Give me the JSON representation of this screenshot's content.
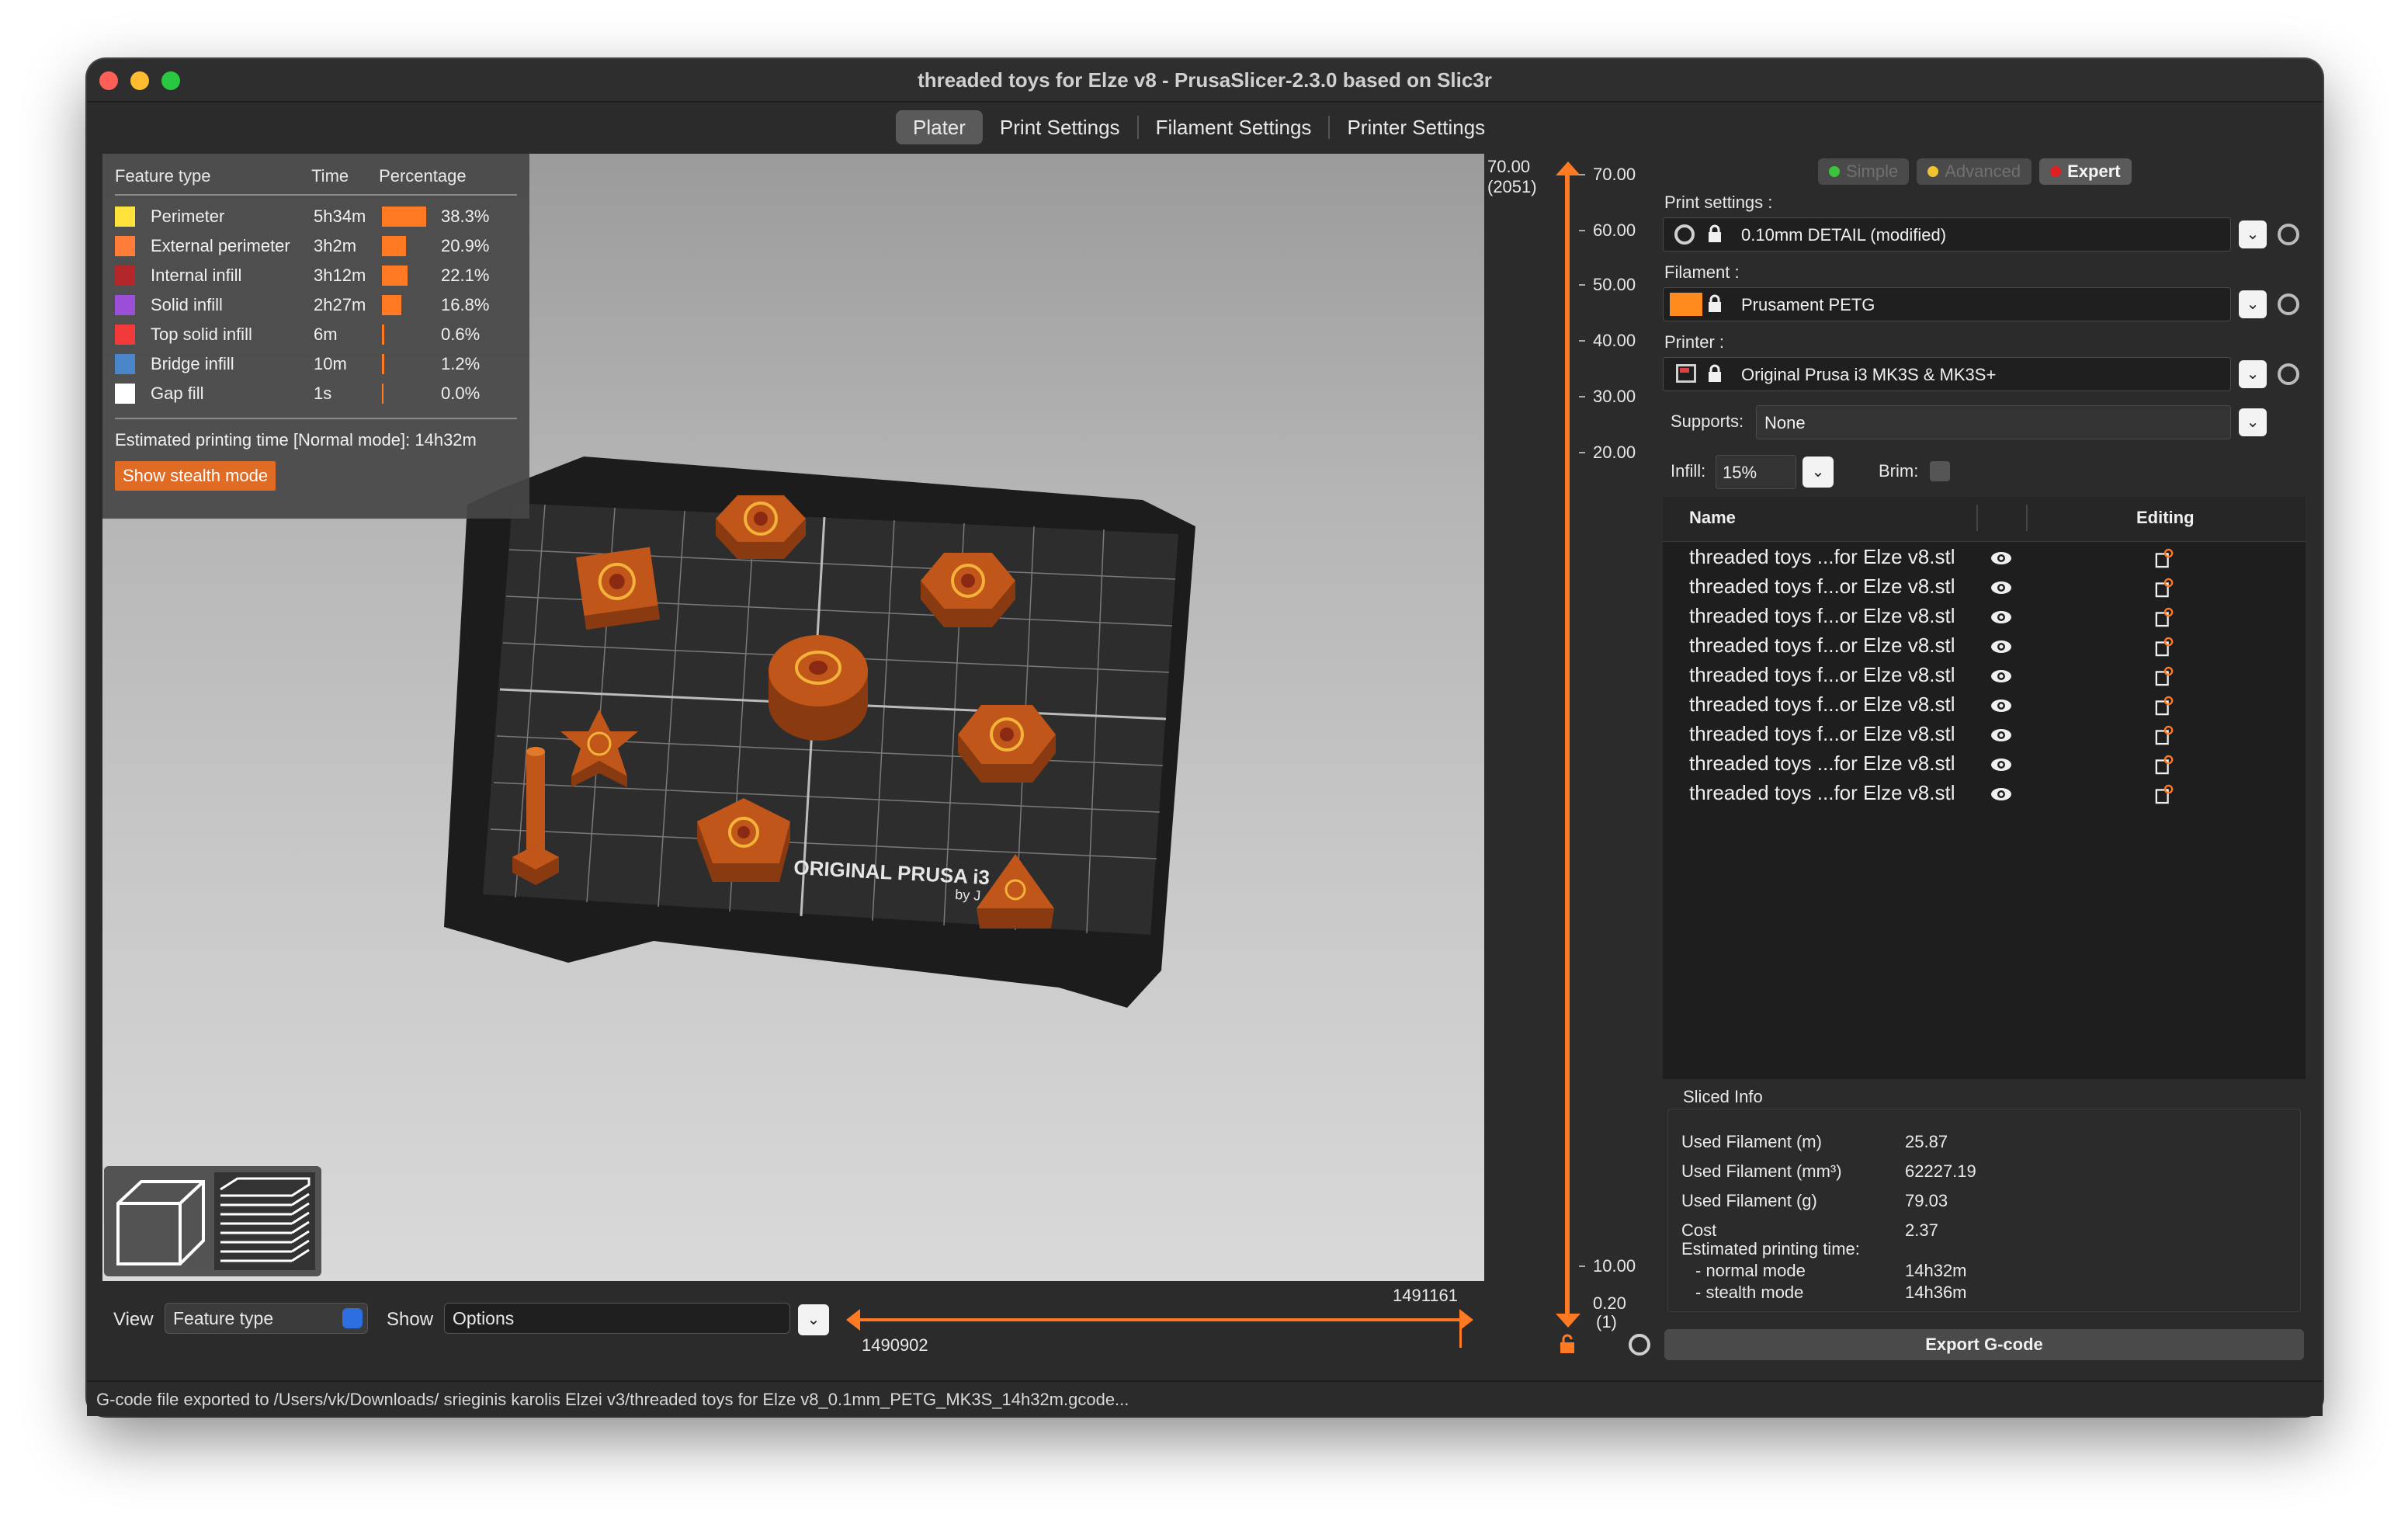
{
  "window": {
    "title": "threaded toys for Elze v8 - PrusaSlicer-2.3.0 based on Slic3r"
  },
  "tabs": [
    {
      "label": "Plater",
      "active": true
    },
    {
      "label": "Print Settings",
      "active": false
    },
    {
      "label": "Filament Settings",
      "active": false
    },
    {
      "label": "Printer Settings",
      "active": false
    }
  ],
  "legend": {
    "headers": [
      "Feature type",
      "Time",
      "Percentage"
    ],
    "rows": [
      {
        "name": "Perimeter",
        "time": "5h34m",
        "percent": "38.3%",
        "fraction": 0.383,
        "color": "#ffe23a"
      },
      {
        "name": "External perimeter",
        "time": "3h2m",
        "percent": "20.9%",
        "fraction": 0.209,
        "color": "#ff7d38"
      },
      {
        "name": "Internal infill",
        "time": "3h12m",
        "percent": "22.1%",
        "fraction": 0.221,
        "color": "#b3262a"
      },
      {
        "name": "Solid infill",
        "time": "2h27m",
        "percent": "16.8%",
        "fraction": 0.168,
        "color": "#9a4fd6"
      },
      {
        "name": "Top solid infill",
        "time": "6m",
        "percent": "0.6%",
        "fraction": 0.006,
        "color": "#f23a3a"
      },
      {
        "name": "Bridge infill",
        "time": "10m",
        "percent": "1.2%",
        "fraction": 0.012,
        "color": "#4a84c9"
      },
      {
        "name": "Gap fill",
        "time": "1s",
        "percent": "0.0%",
        "fraction": 0.0,
        "color": "#ffffff"
      }
    ],
    "estimated": "Estimated printing time [Normal mode]:  14h32m",
    "stealth_button": "Show stealth mode"
  },
  "bed": {
    "brand": "ORIGINAL PRUSA i3",
    "byline": "by J"
  },
  "bottom": {
    "view_label": "View",
    "view_value": "Feature type",
    "show_label": "Show",
    "show_value": "Options",
    "range_high": "1491161",
    "range_low": "1490902"
  },
  "vslider": {
    "top_value": "70.00",
    "top_layer": "(2051)",
    "ticks": [
      "70.00",
      "60.00",
      "50.00",
      "40.00",
      "30.00",
      "20.00",
      "10.00"
    ],
    "bottom_value": "0.20",
    "bottom_layer": "(1)"
  },
  "sidebar": {
    "modes": [
      {
        "label": "Simple",
        "color": "#3cc43c",
        "active": false
      },
      {
        "label": "Advanced",
        "color": "#f0c330",
        "active": false
      },
      {
        "label": "Expert",
        "color": "#e02020",
        "active": true
      }
    ],
    "print_settings_label": "Print settings :",
    "print_settings_value": "0.10mm DETAIL (modified)",
    "filament_label": "Filament :",
    "filament_value": "Prusament PETG",
    "filament_color": "#ff8a1e",
    "printer_label": "Printer :",
    "printer_value": "Original Prusa i3 MK3S & MK3S+",
    "supports_label": "Supports:",
    "supports_value": "None",
    "infill_label": "Infill:",
    "infill_value": "15%",
    "brim_label": "Brim:",
    "list_headers": {
      "name": "Name",
      "editing": "Editing"
    },
    "objects": [
      "threaded toys ...for Elze v8.stl",
      "threaded toys f...or Elze v8.stl",
      "threaded toys f...or Elze v8.stl",
      "threaded toys f...or Elze v8.stl",
      "threaded toys f...or Elze v8.stl",
      "threaded toys f...or Elze v8.stl",
      "threaded toys f...or Elze v8.stl",
      "threaded toys ...for Elze v8.stl",
      "threaded toys ...for Elze v8.stl"
    ],
    "sliced_info": {
      "title": "Sliced Info",
      "rows": [
        {
          "k": "Used Filament (m)",
          "v": "25.87"
        },
        {
          "k": "Used Filament (mm³)",
          "v": "62227.19"
        },
        {
          "k": "Used Filament (g)",
          "v": "79.03"
        },
        {
          "k": "Cost",
          "v": "2.37"
        }
      ],
      "est_title": "Estimated printing time:",
      "normal_label": "- normal mode",
      "normal_value": "14h32m",
      "stealth_label": "- stealth mode",
      "stealth_value": "14h36m"
    },
    "export_button": "Export G-code"
  },
  "status": "G-code file exported to /Users/vk/Downloads/ srieginis karolis Elzei v3/threaded toys for Elze v8_0.1mm_PETG_MK3S_14h32m.gcode..."
}
